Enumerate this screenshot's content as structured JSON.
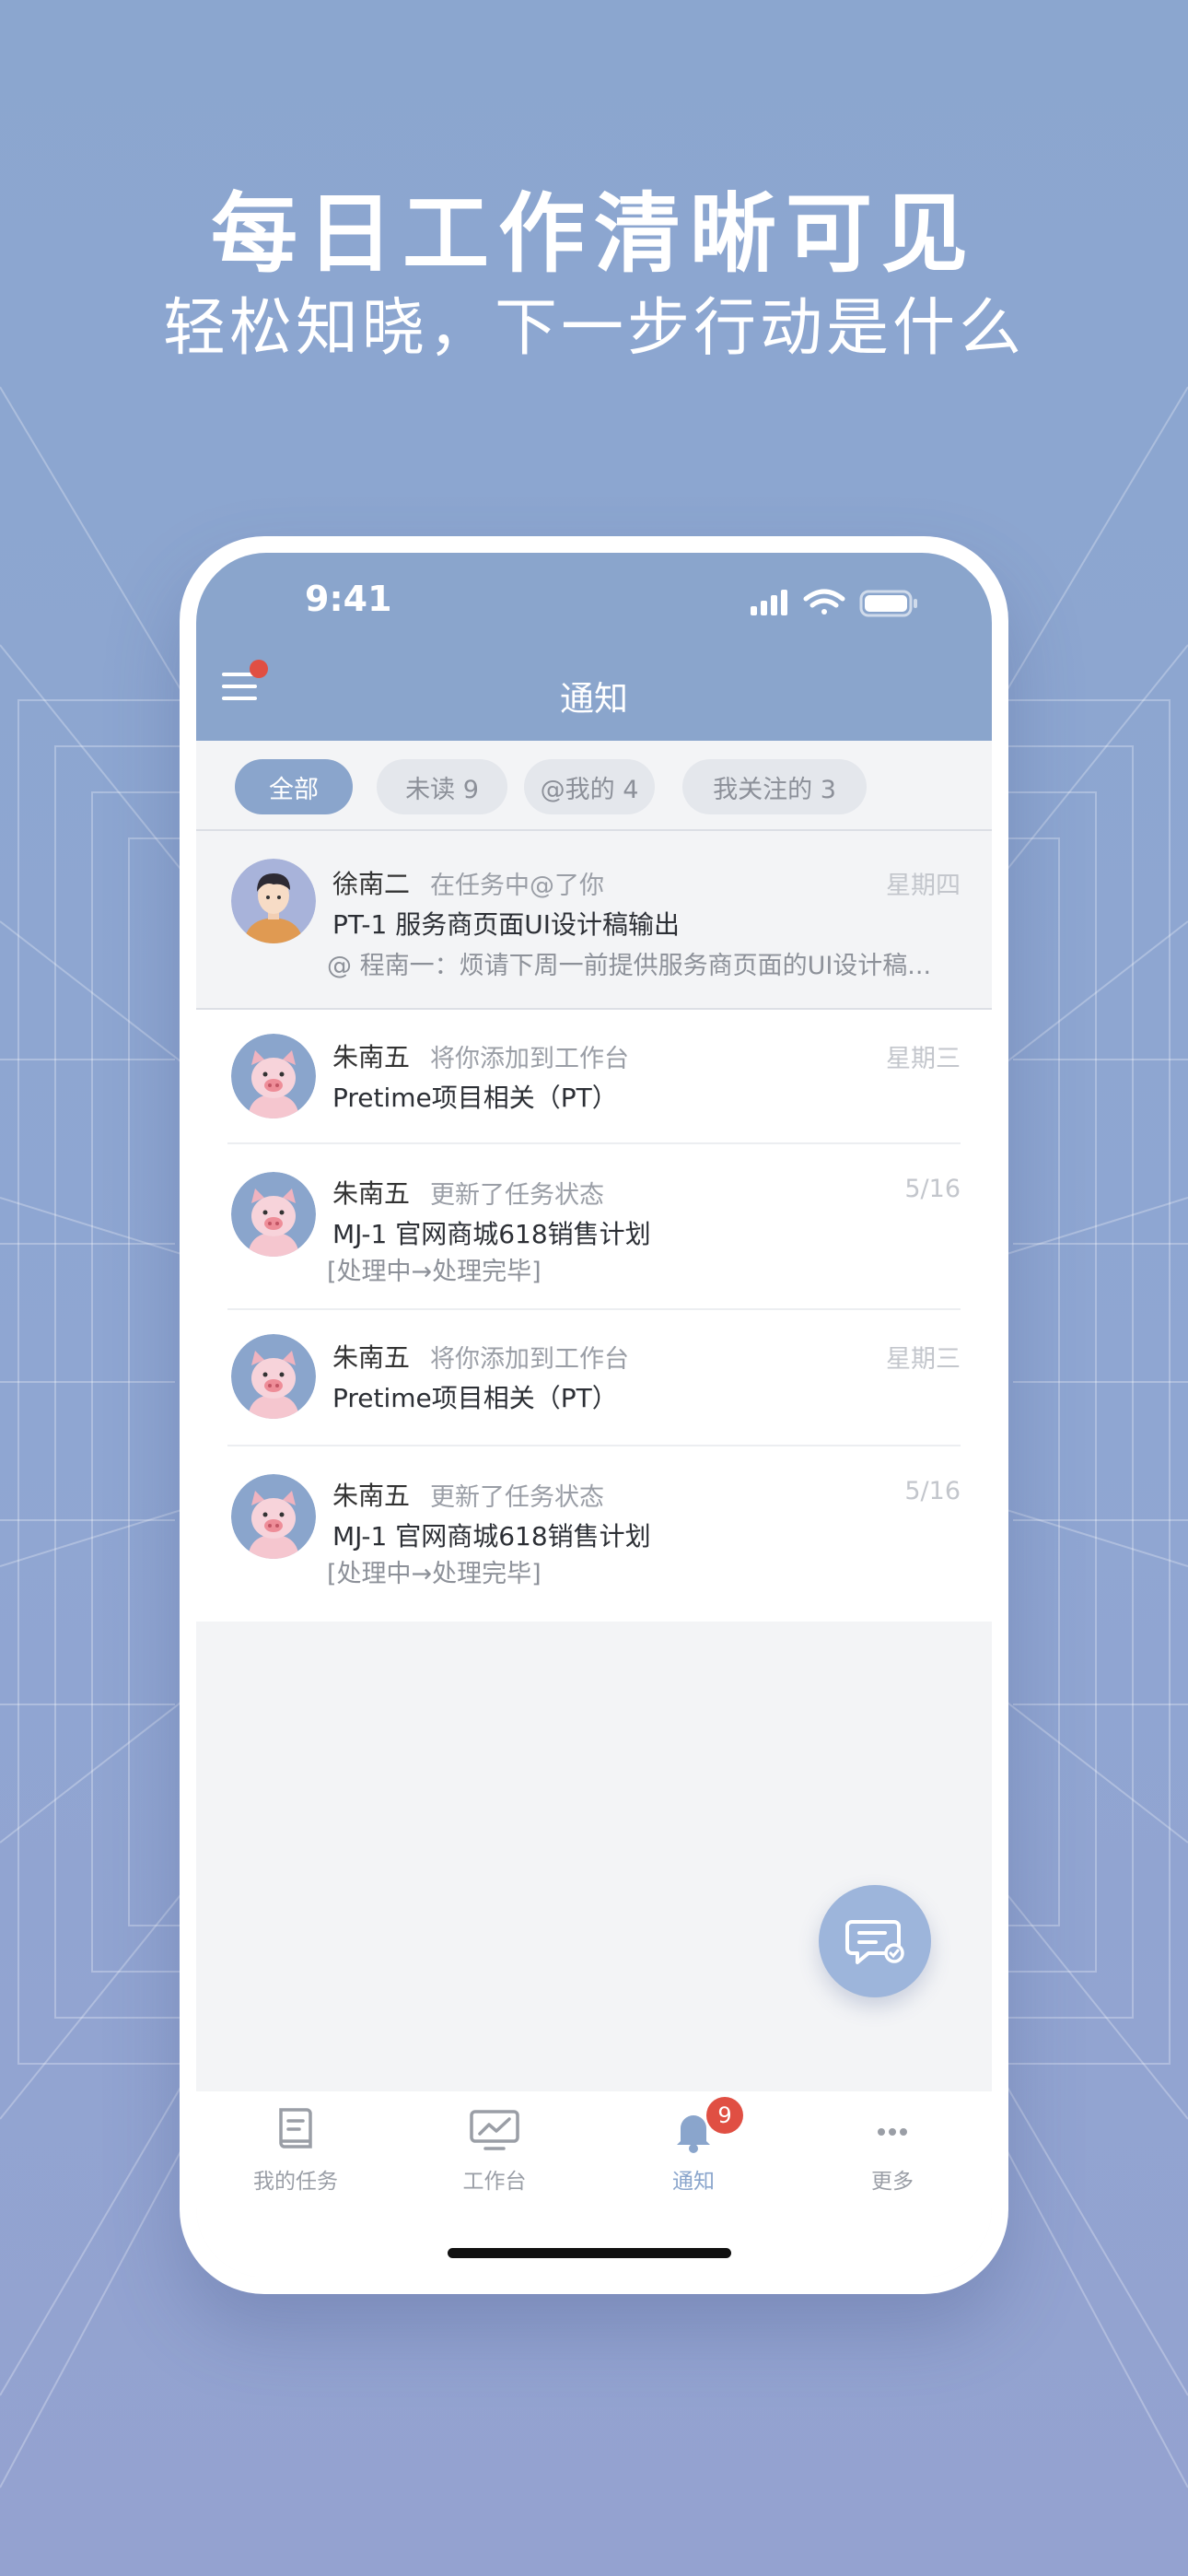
{
  "headline": {
    "title": "每日工作清晰可见",
    "subtitle": "轻松知晓，下一步行动是什么"
  },
  "status_bar": {
    "time": "9:41"
  },
  "app_bar": {
    "title": "通知"
  },
  "filters": [
    {
      "label": "全部",
      "active": true
    },
    {
      "label": "未读 9",
      "active": false
    },
    {
      "label": "@我的 4",
      "active": false
    },
    {
      "label": "我关注的 3",
      "active": false
    }
  ],
  "notifications": [
    {
      "avatar": "person-avatar",
      "name": "徐南二",
      "action": "在任务中@了你",
      "time": "星期四",
      "line2": "PT-1   服务商页面UI设计稿输出",
      "line3": "@ 程南一：烦请下周一前提供服务商页面的UI设计稿..."
    },
    {
      "avatar": "pig-avatar",
      "name": "朱南五",
      "action": "将你添加到工作台",
      "time": "星期三",
      "line2": "Pretime项目相关（PT）",
      "line3": ""
    },
    {
      "avatar": "pig-avatar",
      "name": "朱南五",
      "action": "更新了任务状态",
      "time": "5/16",
      "line2": "MJ-1   官网商城618销售计划",
      "line3": "[处理中→处理完毕]"
    },
    {
      "avatar": "pig-avatar",
      "name": "朱南五",
      "action": "将你添加到工作台",
      "time": "星期三",
      "line2": "Pretime项目相关（PT）",
      "line3": ""
    },
    {
      "avatar": "pig-avatar",
      "name": "朱南五",
      "action": "更新了任务状态",
      "time": "5/16",
      "line2": "MJ-1   官网商城618销售计划",
      "line3": "[处理中→处理完毕]"
    }
  ],
  "tabbar": [
    {
      "label": "我的任务",
      "icon": "tasks-icon",
      "active": false
    },
    {
      "label": "工作台",
      "icon": "workbench-icon",
      "active": false
    },
    {
      "label": "通知",
      "icon": "bell-icon",
      "active": true,
      "badge": "9"
    },
    {
      "label": "更多",
      "icon": "more-icon",
      "active": false
    }
  ],
  "colors": {
    "accent": "#8aa5cc",
    "badge": "#e04f43",
    "background": "#8ba6cf"
  }
}
